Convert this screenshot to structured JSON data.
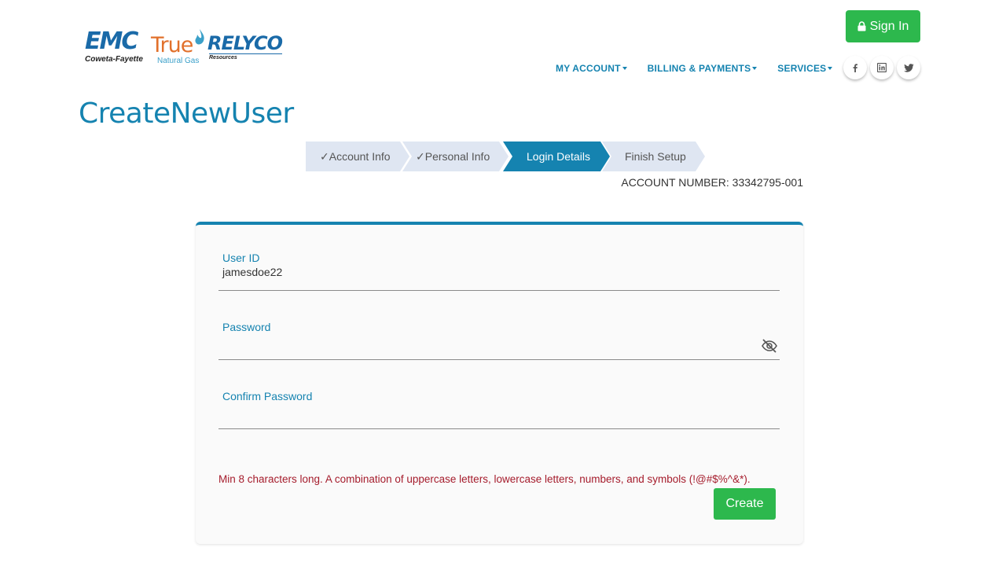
{
  "brand": {
    "emc_logo": "EMC",
    "emc_sub": "Coweta-Fayette",
    "true_logo": "True",
    "true_sub": "Natural Gas",
    "relyco_logo": "RELYCO",
    "relyco_sub": "Resources"
  },
  "header": {
    "signin_label": "Sign In",
    "nav": [
      {
        "label": "MY ACCOUNT"
      },
      {
        "label": "BILLING & PAYMENTS"
      },
      {
        "label": "SERVICES"
      }
    ],
    "social": [
      {
        "icon": "facebook-icon",
        "glyph": "f"
      },
      {
        "icon": "linkedin-icon",
        "glyph": "in"
      },
      {
        "icon": "twitter-icon",
        "glyph": "t"
      }
    ]
  },
  "page": {
    "title": "CreateNewUser"
  },
  "stepper": {
    "steps": [
      {
        "label": "✓Account Info",
        "state": "done"
      },
      {
        "label": "✓Personal Info",
        "state": "done"
      },
      {
        "label": "Login Details",
        "state": "active"
      },
      {
        "label": "Finish Setup",
        "state": "pending"
      }
    ]
  },
  "account": {
    "number_text": "ACCOUNT NUMBER: 33342795-001"
  },
  "form": {
    "user_id_label": "User ID",
    "user_id_value": "jamesdoe22",
    "password_label": "Password",
    "password_value": "",
    "confirm_label": "Confirm Password",
    "confirm_value": "",
    "hint": "Min 8 characters long. A combination of uppercase letters, lowercase letters, numbers, and symbols (!@#$%^&*).",
    "create_label": "Create"
  },
  "colors": {
    "accent": "#1583b0",
    "button_green": "#2db84d",
    "error_red": "#a51c2c",
    "step_pending": "#dfe6f2"
  }
}
